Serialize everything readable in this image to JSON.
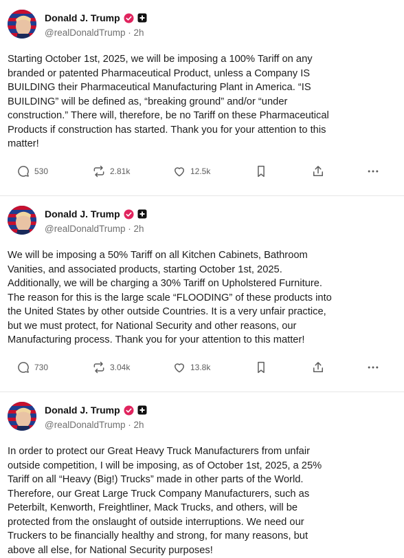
{
  "posts": [
    {
      "author": "Donald J. Trump",
      "handle": "@realDonaldTrump",
      "time": "2h",
      "text": "Starting October 1st, 2025, we will be imposing a 100% Tariff on any\nbranded or patented Pharmaceutical Product, unless a Company IS\nBUILDING their Pharmaceutical Manufacturing Plant in America. “IS\nBUILDING” will be defined as, “breaking ground” and/or “under\nconstruction.” There will, therefore, be no Tariff on these Pharmaceutical\nProducts if construction has started. Thank you for your attention to this\nmatter!",
      "replies": "530",
      "reposts": "2.81k",
      "likes": "12.5k"
    },
    {
      "author": "Donald J. Trump",
      "handle": "@realDonaldTrump",
      "time": "2h",
      "text": "We will be imposing a 50% Tariff on all Kitchen Cabinets, Bathroom\nVanities, and associated products, starting October 1st, 2025.\nAdditionally, we will be charging a 30% Tariff on Upholstered Furniture.\nThe reason for this is the large scale “FLOODING” of these products into\nthe United States by other outside Countries. It is a very unfair practice,\nbut we must protect, for National Security and other reasons, our\nManufacturing process. Thank you for your attention to this matter!",
      "replies": "730",
      "reposts": "3.04k",
      "likes": "13.8k"
    },
    {
      "author": "Donald J. Trump",
      "handle": "@realDonaldTrump",
      "time": "2h",
      "text": "In order to protect our Great Heavy Truck Manufacturers from unfair\noutside competition, I will be imposing, as of October 1st, 2025, a 25%\nTariff on all “Heavy (Big!) Trucks” made in other parts of the World.\nTherefore, our Great Large Truck Company Manufacturers, such as\nPeterbilt, Kenworth, Freightliner, Mack Trucks, and others, will be\nprotected from the onslaught of outside interruptions. We need our\nTruckers to be financially healthy and strong, for many reasons, but\nabove all else, for National Security purposes!"
    }
  ],
  "separator": "·",
  "colors": {
    "verified_badge": "#e0245e",
    "text": "#1c1c1c",
    "muted": "#6f6f6f",
    "divider": "#e6e6e6"
  },
  "icons": [
    "reply-icon",
    "repost-icon",
    "like-icon",
    "bookmark-icon",
    "share-icon",
    "more-icon",
    "verified-icon",
    "plus-badge-icon"
  ]
}
